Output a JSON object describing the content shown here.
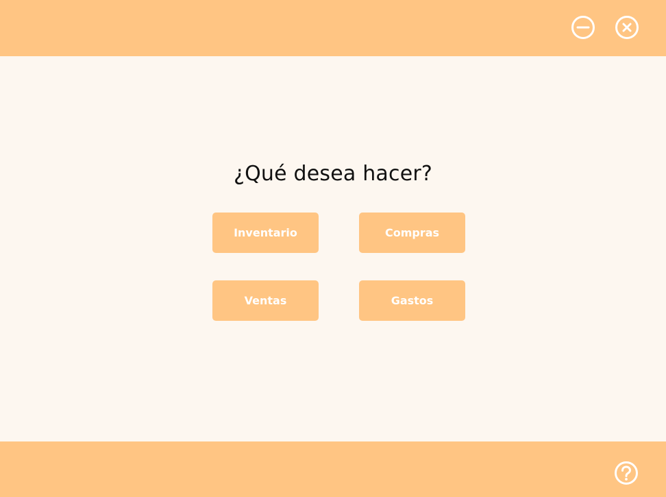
{
  "colors": {
    "accent": "#ffc583",
    "background": "#fdf7f0",
    "title_text": "#111111",
    "button_text": "#ffffff"
  },
  "header": {
    "minimize_icon": "minus-circle-icon",
    "close_icon": "x-circle-icon"
  },
  "main": {
    "title": "¿Qué desea hacer?",
    "buttons": {
      "inventario": "Inventario",
      "compras": "Compras",
      "ventas": "Ventas",
      "gastos": "Gastos"
    }
  },
  "footer": {
    "help_icon": "question-circle-icon"
  }
}
